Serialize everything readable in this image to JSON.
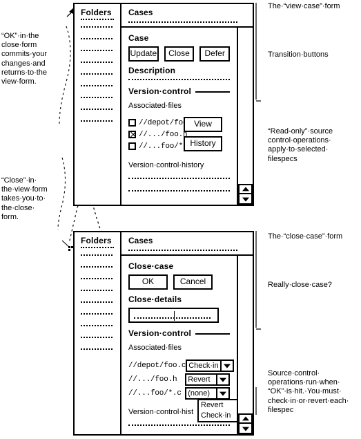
{
  "annotations": {
    "left": [
      {
        "text": "“OK”·in·the\nclose·form\ncommits·your\nchanges·and\nreturns·to·the\nview·form."
      },
      {
        "text": "“Close”·in·\nthe·view·form\ntakes·you·to·\nthe·close·\nform."
      }
    ],
    "right": [
      {
        "text": "The·“view·case”·form"
      },
      {
        "text": "Transition·buttons"
      },
      {
        "text": "“Read-only”·source\ncontrol·operations·\napply·to·selected·\nfilespecs"
      },
      {
        "text": "The·“close·case”·form"
      },
      {
        "text": "Really·close·case?"
      },
      {
        "text": "Source·control·\noperations·run·when·\n“OK”·is·hit.·You·must·\ncheck·in·or·revert·each·\nfilespec"
      }
    ]
  },
  "view_form": {
    "folders": {
      "title": "Folders",
      "row_count": 9
    },
    "cases": {
      "title": "Cases"
    },
    "case_section": {
      "title": "Case"
    },
    "transition_buttons": [
      {
        "label": "Update"
      },
      {
        "label": "Close"
      },
      {
        "label": "Defer"
      }
    ],
    "description": {
      "title": "Description"
    },
    "version_control": {
      "title": "Version·control",
      "associated_files_label": "Associated·files",
      "files": [
        {
          "path": "//depot/foo.c",
          "checked": false
        },
        {
          "path": "//.../foo.h",
          "checked": true
        },
        {
          "path": "//...foo/*.c",
          "checked": false
        }
      ],
      "file_buttons": [
        {
          "label": "View"
        },
        {
          "label": "History"
        }
      ],
      "history_label": "Version·control·history"
    }
  },
  "close_form": {
    "folders": {
      "title": "Folders",
      "row_count": 9
    },
    "cases": {
      "title": "Cases"
    },
    "close_section": {
      "title": "Close·case"
    },
    "confirm_buttons": [
      {
        "label": "OK"
      },
      {
        "label": "Cancel"
      }
    ],
    "close_details": {
      "title": "Close·details",
      "value": ""
    },
    "version_control": {
      "title": "Version·control",
      "associated_files_label": "Associated·files",
      "files": [
        {
          "path": "//depot/foo.c",
          "action": "Check·in"
        },
        {
          "path": "//.../foo.h",
          "action": "Revert"
        },
        {
          "path": "//...foo/*.c",
          "action": "(none)"
        }
      ],
      "open_dropdown_options": [
        "Revert",
        "Check·in"
      ],
      "history_label": "Version·control·hist"
    }
  },
  "icons": {
    "scroll_up": "scroll-up-arrow-icon",
    "scroll_down": "scroll-down-arrow-icon",
    "dropdown": "chevron-down-icon",
    "pointer": "mouse-pointer-icon"
  },
  "colors": {
    "ink": "#000000",
    "paper": "#ffffff"
  }
}
